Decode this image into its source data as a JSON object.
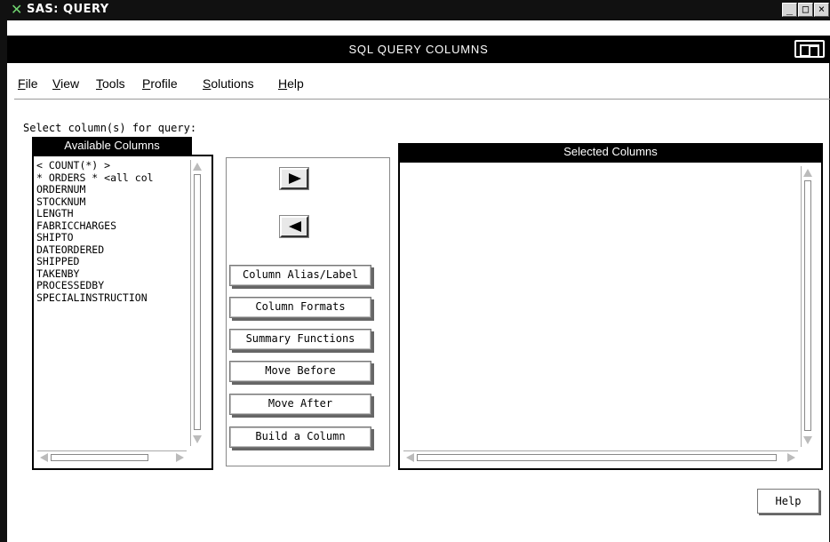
{
  "window": {
    "title": "SAS: QUERY",
    "header": "SQL QUERY COLUMNS",
    "minimize_glyph": "_",
    "maximize_glyph": "□",
    "close_glyph": "×"
  },
  "menu": [
    "File",
    "View",
    "Tools",
    "Profile",
    "Solutions",
    "Help"
  ],
  "menu_mnemonics": [
    "F",
    "V",
    "T",
    "P",
    "S",
    "H"
  ],
  "prompt": "Select column(s) for query:",
  "available": {
    "header": "Available Columns",
    "items": [
      "< COUNT(*) >",
      "* ORDERS * <all col",
      "ORDERNUM",
      "STOCKNUM",
      "LENGTH",
      "FABRICCHARGES",
      "SHIPTO",
      "DATEORDERED",
      "SHIPPED",
      "TAKENBY",
      "PROCESSEDBY",
      "SPECIALINSTRUCTION"
    ]
  },
  "selected": {
    "header": "Selected Columns",
    "items": []
  },
  "buttons": {
    "add": "right-arrow-icon",
    "remove": "left-arrow-icon",
    "alias": "Column Alias/Label",
    "formats": "Column Formats",
    "summary": "Summary Functions",
    "before": "Move Before",
    "after": "Move After",
    "build": "Build a Column",
    "help": "Help"
  },
  "colors": {
    "titlebar": "#111111",
    "panel_header": "#000000",
    "background": "#ffffff"
  }
}
